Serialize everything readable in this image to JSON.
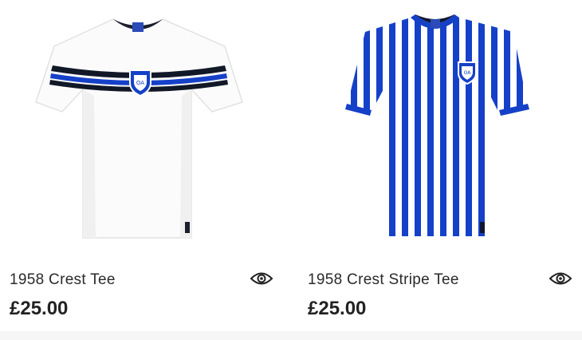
{
  "products": [
    {
      "title": "1958 Crest Tee",
      "price": "£25.00",
      "image_icon": "white-tee-image",
      "quick_view_icon": "eye-icon"
    },
    {
      "title": "1958 Crest Stripe Tee",
      "price": "£25.00",
      "image_icon": "stripe-tee-image",
      "quick_view_icon": "eye-icon"
    }
  ],
  "colors": {
    "royal_blue": "#1540c8",
    "navy": "#101828",
    "text": "#2a2a2a"
  }
}
